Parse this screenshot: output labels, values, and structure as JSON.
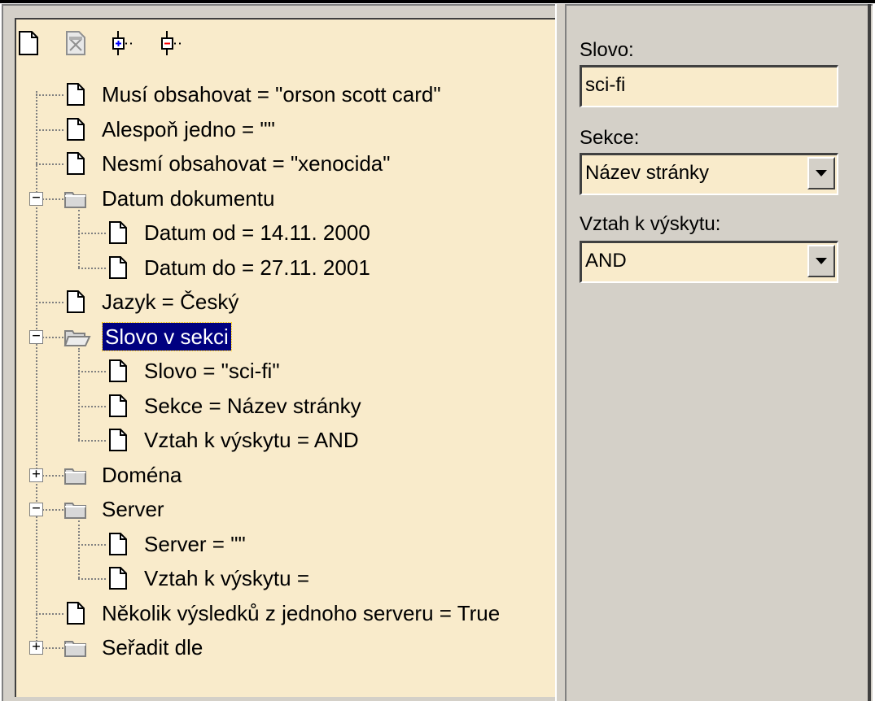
{
  "toolbar": {
    "buttons": [
      {
        "name": "new-document-icon"
      },
      {
        "name": "delete-document-icon"
      },
      {
        "name": "add-node-icon"
      },
      {
        "name": "remove-node-icon"
      }
    ]
  },
  "tree": {
    "items": [
      {
        "label": "Musí obsahovat = \"orson scott card\"",
        "type": "doc",
        "level": 0
      },
      {
        "label": "Alespoň jedno = \"\"",
        "type": "doc",
        "level": 0
      },
      {
        "label": "Nesmí obsahovat = \"xenocida\"",
        "type": "doc",
        "level": 0
      },
      {
        "label": "Datum dokumentu",
        "type": "folder",
        "level": 0,
        "expanded": true
      },
      {
        "label": "Datum od = 14.11. 2000",
        "type": "doc",
        "level": 1
      },
      {
        "label": "Datum do = 27.11. 2001",
        "type": "doc",
        "level": 1
      },
      {
        "label": "Jazyk = Český",
        "type": "doc",
        "level": 0
      },
      {
        "label": "Slovo v sekci",
        "type": "folder-open",
        "level": 0,
        "expanded": true,
        "selected": true
      },
      {
        "label": "Slovo = \"sci-fi\"",
        "type": "doc",
        "level": 1
      },
      {
        "label": "Sekce = Název stránky",
        "type": "doc",
        "level": 1
      },
      {
        "label": "Vztah k výskytu = AND",
        "type": "doc",
        "level": 1
      },
      {
        "label": "Doména",
        "type": "folder",
        "level": 0,
        "expanded": false
      },
      {
        "label": "Server",
        "type": "folder",
        "level": 0,
        "expanded": true
      },
      {
        "label": "Server = \"\"",
        "type": "doc",
        "level": 1
      },
      {
        "label": "Vztah k výskytu =",
        "type": "doc",
        "level": 1
      },
      {
        "label": "Několik výsledků z jednoho serveru = True",
        "type": "doc",
        "level": 0
      },
      {
        "label": "Seřadit dle",
        "type": "folder",
        "level": 0,
        "expanded": false
      }
    ]
  },
  "form": {
    "slovo_label": "Slovo:",
    "slovo_value": "sci-fi",
    "sekce_label": "Sekce:",
    "sekce_value": "Název stránky",
    "vztah_label": "Vztah k výskytu:",
    "vztah_value": "AND"
  },
  "colors": {
    "pane_bg": "#f9ebcb",
    "window_bg": "#d4d0c8",
    "selection_bg": "#000080"
  }
}
